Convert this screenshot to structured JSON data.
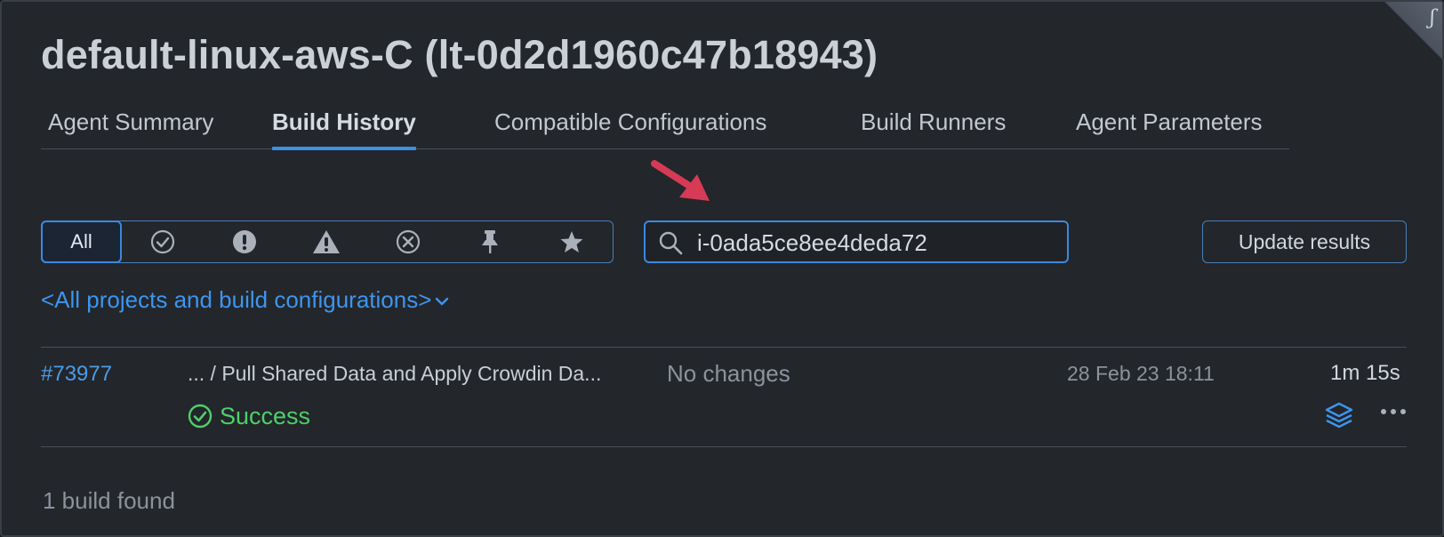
{
  "page": {
    "title": "default-linux-aws-C (lt-0d2d1960c47b18943)",
    "corner_badge_icon": "plugin-badge-icon"
  },
  "tabs": [
    {
      "label": "Agent Summary",
      "active": false
    },
    {
      "label": "Build History",
      "active": true
    },
    {
      "label": "Compatible Configurations",
      "active": false
    },
    {
      "label": "Build Runners",
      "active": false
    },
    {
      "label": "Agent Parameters",
      "active": false
    }
  ],
  "filters": {
    "all_label": "All",
    "icons": [
      "check-circle-icon",
      "exclamation-circle-icon",
      "warning-triangle-icon",
      "x-circle-icon",
      "pin-icon",
      "star-icon"
    ]
  },
  "search": {
    "value": "i-0ada5ce8ee4deda72",
    "icon": "search-icon"
  },
  "update_button": {
    "label": "Update results"
  },
  "project_filter": {
    "label": "<All projects and build configurations>"
  },
  "builds": [
    {
      "number": "#73977",
      "configuration": "... / Pull Shared Data and Apply Crowdin Da...",
      "changes": "No changes",
      "date": "28 Feb 23 18:11",
      "duration": "1m 15s",
      "status": "Success"
    }
  ],
  "summary": {
    "found": "1 build found"
  },
  "colors": {
    "accent": "#3d8fe6",
    "link": "#3d95ee",
    "success": "#4fcf6a",
    "annotation_arrow": "#d63a55"
  }
}
